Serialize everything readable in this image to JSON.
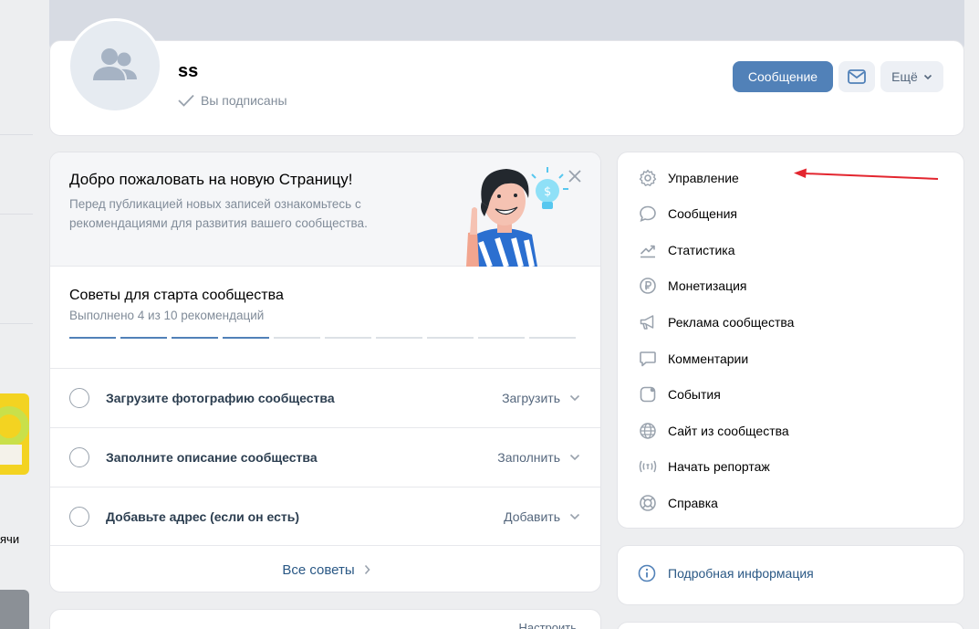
{
  "header": {
    "title": "ss",
    "subscribed_text": "Вы подписаны",
    "message_button": "Сообщение",
    "more_button": "Ещё"
  },
  "welcome": {
    "title": "Добро пожаловать на новую Страницу!",
    "text": "Перед публикацией новых записей ознакомьтесь с рекомендациями для развития вашего сообщества."
  },
  "tips": {
    "title": "Советы для старта сообщества",
    "progress_text": "Выполнено 4 из 10 рекомендаций",
    "completed": 4,
    "total": 10,
    "tasks": [
      {
        "label": "Загрузите фотографию сообщества",
        "action": "Загрузить"
      },
      {
        "label": "Заполните описание сообщества",
        "action": "Заполнить"
      },
      {
        "label": "Добавьте адрес (если он есть)",
        "action": "Добавить"
      }
    ],
    "all_tips_label": "Все советы"
  },
  "next_card": {
    "action_cut": "Настроить"
  },
  "left_strip": {
    "cut_text": "ячи"
  },
  "menu": {
    "items": [
      {
        "label": "Управление",
        "icon": "gear-icon"
      },
      {
        "label": "Сообщения",
        "icon": "chat-bubble-icon"
      },
      {
        "label": "Статистика",
        "icon": "chart-trend-icon"
      },
      {
        "label": "Монетизация",
        "icon": "ruble-coin-icon"
      },
      {
        "label": "Реклама сообщества",
        "icon": "megaphone-icon"
      },
      {
        "label": "Комментарии",
        "icon": "comment-icon"
      },
      {
        "label": "События",
        "icon": "event-icon"
      },
      {
        "label": "Сайт из сообщества",
        "icon": "globe-icon"
      },
      {
        "label": "Начать репортаж",
        "icon": "broadcast-icon"
      },
      {
        "label": "Справка",
        "icon": "lifebuoy-icon"
      }
    ]
  },
  "info": {
    "label": "Подробная информация",
    "icon": "info-icon"
  },
  "colors": {
    "accent": "#5181b8",
    "link": "#2a5885",
    "muted": "#818c99",
    "annotation": "#e3262f"
  }
}
